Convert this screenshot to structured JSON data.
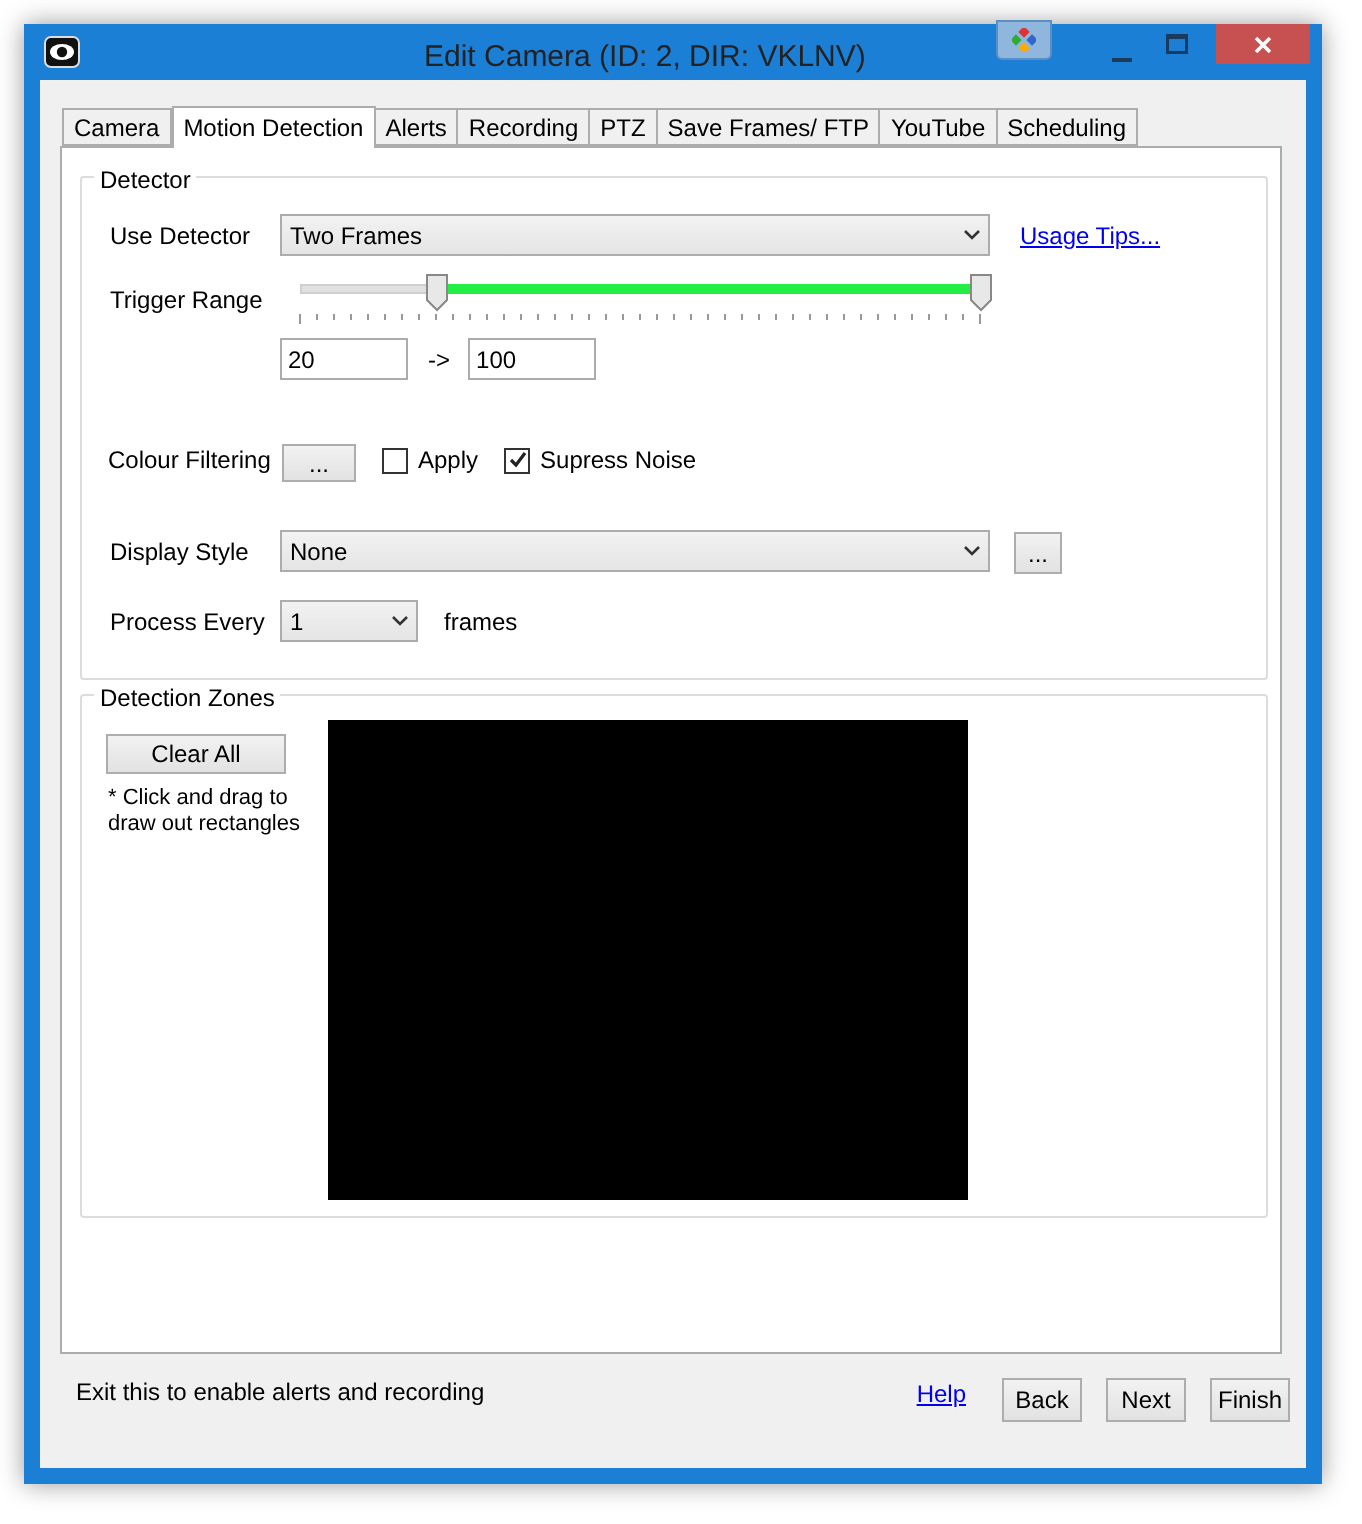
{
  "window": {
    "title": "Edit Camera (ID: 2, DIR: VKLNV)"
  },
  "tabs": [
    {
      "label": "Camera",
      "selected": false
    },
    {
      "label": "Motion Detection",
      "selected": true
    },
    {
      "label": "Alerts",
      "selected": false
    },
    {
      "label": "Recording",
      "selected": false
    },
    {
      "label": "PTZ",
      "selected": false
    },
    {
      "label": "Save Frames/ FTP",
      "selected": false
    },
    {
      "label": "YouTube",
      "selected": false
    },
    {
      "label": "Scheduling",
      "selected": false
    }
  ],
  "detector": {
    "title": "Detector",
    "use_detector": {
      "label": "Use Detector",
      "value": "Two Frames",
      "link": "Usage Tips..."
    },
    "trigger_range": {
      "label": "Trigger Range",
      "thumbs": [
        {
          "level": 0.2
        },
        {
          "level": 1
        }
      ],
      "from": "20",
      "arrow": "->",
      "to": "100"
    },
    "colour_filtering": {
      "label": "Colour Filtering",
      "button": "...",
      "checkboxes": [
        {
          "label": "Apply",
          "checked": false
        },
        {
          "label": "Supress Noise",
          "checked": true
        }
      ]
    },
    "display_style": {
      "label": "Display Style",
      "value": "None",
      "button": "..."
    },
    "process_every": {
      "label": "Process Every",
      "value": "1",
      "unit": "frames"
    }
  },
  "detection_zones": {
    "title": "Detection Zones",
    "button": "Clear All",
    "hint": "* Click and drag to draw out rectangles"
  },
  "footer": {
    "message": "Exit this to enable alerts and recording",
    "link": "Help",
    "buttons": [
      "Back",
      "Next",
      "Finish"
    ]
  }
}
